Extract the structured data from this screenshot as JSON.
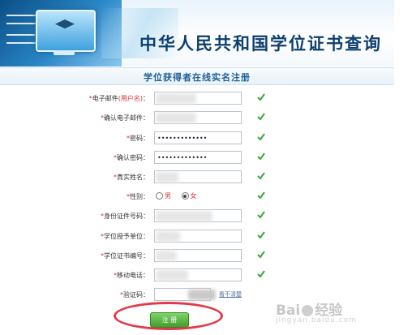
{
  "header": {
    "title": "中华人民共和国学位证书查询"
  },
  "form": {
    "heading": "学位获得者在线实名注册",
    "fields": [
      {
        "label": "电子邮件",
        "hint": "(用户名)",
        "required": true,
        "value": "",
        "masked": false
      },
      {
        "label": "确认电子邮件：",
        "required": true,
        "value": "",
        "masked": false
      },
      {
        "label": "密码：",
        "required": true,
        "value": "•••••••••••••",
        "masked": true
      },
      {
        "label": "确认密码：",
        "required": true,
        "value": "•••••••••••••",
        "masked": true
      },
      {
        "label": "真实姓名：",
        "required": true,
        "value": "",
        "masked": false
      },
      {
        "label": "身份证件号码：",
        "required": true,
        "value": "",
        "masked": false
      },
      {
        "label": "学位授予单位：",
        "required": true,
        "value": "",
        "masked": false
      },
      {
        "label": "学位证书编号：",
        "required": true,
        "value": "",
        "masked": false
      },
      {
        "label": "移动电话：",
        "required": true,
        "value": "",
        "masked": false
      },
      {
        "label": "验证码：",
        "required": true,
        "value": "",
        "masked": false
      }
    ],
    "gender": {
      "label": "性别：",
      "options": [
        "男",
        "女"
      ],
      "selected": "女"
    },
    "captcha_refresh": "看不清楚",
    "submit_label": "注 册"
  },
  "watermark": {
    "brand": "Bai",
    "brand2": "经验",
    "sub": "jingyan.baidu.com"
  },
  "colors": {
    "accent": "#1f5f98",
    "required": "#e03030",
    "check": "#3aa63a",
    "highlight": "#e4384a"
  }
}
